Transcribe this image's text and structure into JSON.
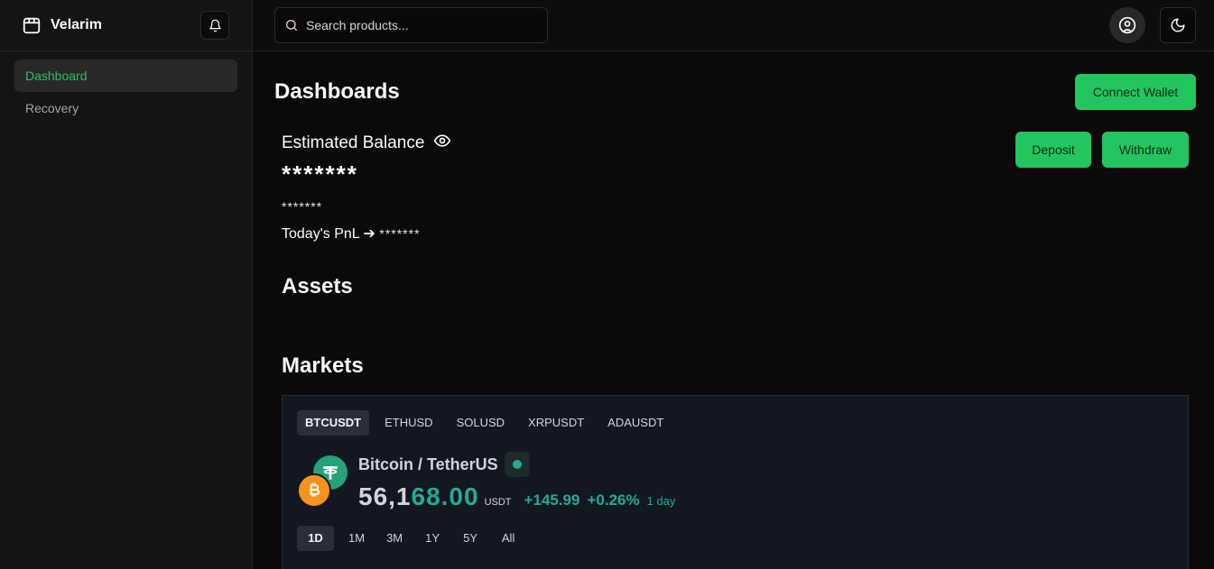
{
  "sidebar": {
    "brand": "Velarim",
    "items": [
      {
        "label": "Dashboard",
        "active": true
      },
      {
        "label": "Recovery",
        "active": false
      }
    ]
  },
  "topbar": {
    "search_placeholder": "Search products..."
  },
  "main": {
    "title": "Dashboards",
    "connect_wallet": "Connect Wallet",
    "deposit": "Deposit",
    "withdraw": "Withdraw",
    "balance_label": "Estimated Balance",
    "balance_value": "*******",
    "balance_sub": "*******",
    "pnl_label": "Today's PnL ➔",
    "pnl_value": "*******",
    "assets_title": "Assets",
    "markets_title": "Markets"
  },
  "markets": {
    "symbols": [
      "BTCUSDT",
      "ETHUSD",
      "SOLUSD",
      "XRPUSDT",
      "ADAUSDT"
    ],
    "active_symbol": "BTCUSDT",
    "pair_name": "Bitcoin / TetherUS",
    "price_part1": "56,1",
    "price_part2": "68.00",
    "unit": "USDT",
    "change": "+145.99",
    "change_pct": "+0.26%",
    "period": "1 day",
    "ranges": [
      "1D",
      "1M",
      "3M",
      "1Y",
      "5Y",
      "All"
    ],
    "active_range": "1D"
  },
  "colors": {
    "accent": "#22c55e",
    "positive": "#22ab94",
    "widget_bg": "#131722",
    "bitcoin": "#f7931a",
    "tether": "#26a17b"
  },
  "icons": {
    "brand": "package-icon",
    "bell": "bell-icon",
    "search": "search-icon",
    "user": "user-circle-icon",
    "theme": "moon-icon",
    "visibility": "eye-icon"
  }
}
